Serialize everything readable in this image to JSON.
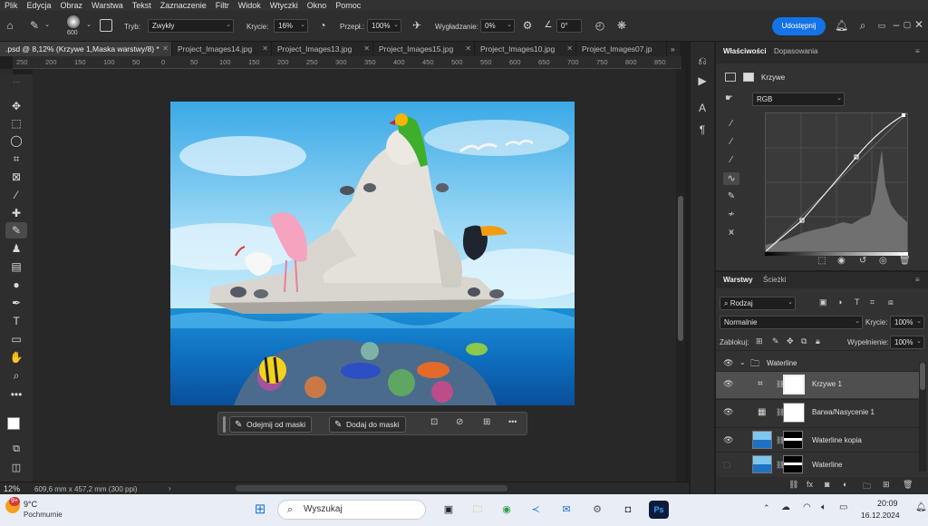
{
  "menu": [
    "Plik",
    "Edycja",
    "Obraz",
    "Warstwa",
    "Tekst",
    "Zaznaczenie",
    "Filtr",
    "Widok",
    "Wtyczki",
    "Okno",
    "Pomoc"
  ],
  "options": {
    "brush_size": "600",
    "mode_label": "Tryb:",
    "mode_value": "Zwykły",
    "opacity_label": "Krycie:",
    "opacity_value": "16%",
    "flow_label": "Przepł.:",
    "flow_value": "100%",
    "smoothing_label": "Wygładzanie:",
    "smoothing_value": "0%",
    "angle_value": "0°",
    "share_label": "Udostępnij"
  },
  "tabs": [
    {
      "label": ".psd @ 8,12% (Krzywe 1,Maska warstwy/8) *",
      "active": true
    },
    {
      "label": "Project_Images14.jpg"
    },
    {
      "label": "Project_Images13.jpg"
    },
    {
      "label": "Project_Images15.jpg"
    },
    {
      "label": "Project_Images10.jpg"
    },
    {
      "label": "Project_Images07.jp"
    }
  ],
  "ruler_h": [
    "250",
    "200",
    "150",
    "100",
    "50",
    "0",
    "50",
    "100",
    "150",
    "200",
    "250",
    "300",
    "350",
    "400",
    "450",
    "500",
    "550",
    "600",
    "650",
    "700",
    "750",
    "800",
    "850"
  ],
  "context_bar": {
    "subtract_label": "Odejmij od maski",
    "add_label": "Dodaj do maski",
    "more": "•••"
  },
  "status": {
    "zoom": "12%",
    "doc_size": "609,6 mm x 457,2 mm (300 ppi)"
  },
  "properties": {
    "tab_properties": "Właściwości",
    "tab_adjustments": "Dopasowania",
    "layer_type": "Krzywe",
    "channel": "RGB"
  },
  "layers_panel": {
    "tab_layers": "Warstwy",
    "tab_paths": "Ścieżki",
    "filter_kind": "Rodzaj",
    "blend_mode": "Normalnie",
    "opacity_label": "Krycie:",
    "opacity_value": "100%",
    "lock_label": "Zablokuj:",
    "fill_label": "Wypełnienie:",
    "fill_value": "100%",
    "layers": [
      {
        "name": "Waterline",
        "type": "group"
      },
      {
        "name": "Krzywe 1",
        "type": "adjustment",
        "selected": true
      },
      {
        "name": "Barwa/Nasycenie 1",
        "type": "adjustment"
      },
      {
        "name": "Waterline kopia",
        "type": "image"
      },
      {
        "name": "Waterline",
        "type": "image"
      }
    ]
  },
  "taskbar": {
    "weather_temp": "9°C",
    "weather_desc": "Pochmurnie",
    "notification_badge": "9+",
    "search_placeholder": "Wyszukaj",
    "time": "20:09",
    "date": "16.12.2024"
  },
  "colors": {
    "accent": "#1473e6",
    "panel_bg": "#323232",
    "canvas_bg": "#282828"
  }
}
